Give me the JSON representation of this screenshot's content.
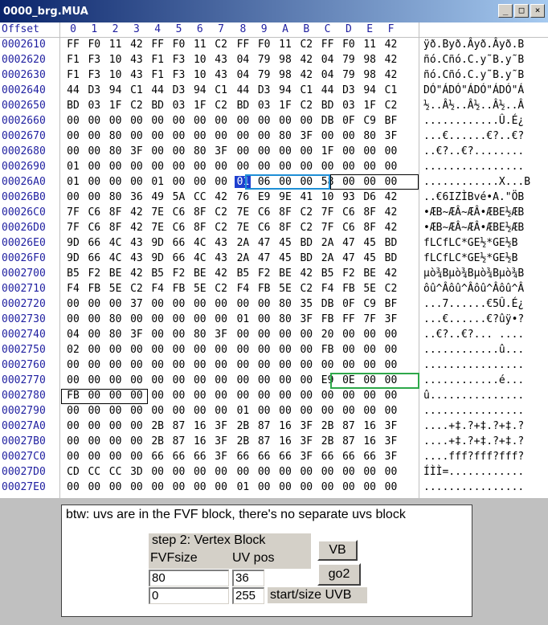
{
  "window": {
    "title": "0000_brg.MUA",
    "minimize": "_",
    "maximize": "□",
    "close": "×"
  },
  "hex": {
    "offset_header": "Offset",
    "columns": [
      "0",
      "1",
      "2",
      "3",
      "4",
      "5",
      "6",
      "7",
      "8",
      "9",
      "A",
      "B",
      "C",
      "D",
      "E",
      "F"
    ],
    "rows": [
      {
        "offset": "0002610",
        "bytes": [
          "FF",
          "F0",
          "11",
          "42",
          "FF",
          "F0",
          "11",
          "C2",
          "FF",
          "F0",
          "11",
          "C2",
          "FF",
          "F0",
          "11",
          "42"
        ],
        "ascii": "ÿð.Byð.Âyð.Âyð.B"
      },
      {
        "offset": "0002620",
        "bytes": [
          "F1",
          "F3",
          "10",
          "43",
          "F1",
          "F3",
          "10",
          "43",
          "04",
          "79",
          "98",
          "42",
          "04",
          "79",
          "98",
          "42"
        ],
        "ascii": "ñó.Cñó.C.y˜B.y˜B"
      },
      {
        "offset": "0002630",
        "bytes": [
          "F1",
          "F3",
          "10",
          "43",
          "F1",
          "F3",
          "10",
          "43",
          "04",
          "79",
          "98",
          "42",
          "04",
          "79",
          "98",
          "42"
        ],
        "ascii": "ñó.Cñó.C.y˜B.y˜B"
      },
      {
        "offset": "0002640",
        "bytes": [
          "44",
          "D3",
          "94",
          "C1",
          "44",
          "D3",
          "94",
          "C1",
          "44",
          "D3",
          "94",
          "C1",
          "44",
          "D3",
          "94",
          "C1"
        ],
        "ascii": "DÓ\"ÁDÓ\"ÁDÓ\"ÁDÓ\"Á"
      },
      {
        "offset": "0002650",
        "bytes": [
          "BD",
          "03",
          "1F",
          "C2",
          "BD",
          "03",
          "1F",
          "C2",
          "BD",
          "03",
          "1F",
          "C2",
          "BD",
          "03",
          "1F",
          "C2"
        ],
        "ascii": "½..Â½..Â½..Â½..Â"
      },
      {
        "offset": "0002660",
        "bytes": [
          "00",
          "00",
          "00",
          "00",
          "00",
          "00",
          "00",
          "00",
          "00",
          "00",
          "00",
          "00",
          "DB",
          "0F",
          "C9",
          "BF"
        ],
        "ascii": "............Û.É¿"
      },
      {
        "offset": "0002670",
        "bytes": [
          "00",
          "00",
          "80",
          "00",
          "00",
          "00",
          "00",
          "00",
          "00",
          "00",
          "80",
          "3F",
          "00",
          "00",
          "80",
          "3F"
        ],
        "ascii": "...€......€?..€?"
      },
      {
        "offset": "0002680",
        "bytes": [
          "00",
          "00",
          "80",
          "3F",
          "00",
          "00",
          "80",
          "3F",
          "00",
          "00",
          "00",
          "00",
          "1F",
          "00",
          "00",
          "00"
        ],
        "ascii": "..€?..€?........"
      },
      {
        "offset": "0002690",
        "bytes": [
          "01",
          "00",
          "00",
          "00",
          "00",
          "00",
          "00",
          "00",
          "00",
          "00",
          "00",
          "00",
          "00",
          "00",
          "00",
          "00"
        ],
        "ascii": "................"
      },
      {
        "offset": "00026A0",
        "bytes": [
          "01",
          "00",
          "00",
          "00",
          "01",
          "00",
          "00",
          "00",
          "01",
          "06",
          "00",
          "00",
          "58",
          "00",
          "00",
          "00"
        ],
        "ascii": "............X...B"
      },
      {
        "offset": "00026B0",
        "bytes": [
          "00",
          "00",
          "80",
          "36",
          "49",
          "5A",
          "CC",
          "42",
          "76",
          "E9",
          "9E",
          "41",
          "10",
          "93",
          "D6",
          "42"
        ],
        "ascii": "..€6IZÌBvé•A.\"ÖB"
      },
      {
        "offset": "00026C0",
        "bytes": [
          "7F",
          "C6",
          "8F",
          "42",
          "7E",
          "C6",
          "8F",
          "C2",
          "7E",
          "C6",
          "8F",
          "C2",
          "7F",
          "C6",
          "8F",
          "42"
        ],
        "ascii": "•ÆB~ÆÂ~ÆÂ•ÆBE½ÆB"
      },
      {
        "offset": "00026D0",
        "bytes": [
          "7F",
          "C6",
          "8F",
          "42",
          "7E",
          "C6",
          "8F",
          "C2",
          "7E",
          "C6",
          "8F",
          "C2",
          "7F",
          "C6",
          "8F",
          "42"
        ],
        "ascii": "•ÆB~ÆÂ~ÆÂ•ÆBE½ÆB"
      },
      {
        "offset": "00026E0",
        "bytes": [
          "9D",
          "66",
          "4C",
          "43",
          "9D",
          "66",
          "4C",
          "43",
          "2A",
          "47",
          "45",
          "BD",
          "2A",
          "47",
          "45",
          "BD"
        ],
        "ascii": "fLCfLC*GE½*GE½B"
      },
      {
        "offset": "00026F0",
        "bytes": [
          "9D",
          "66",
          "4C",
          "43",
          "9D",
          "66",
          "4C",
          "43",
          "2A",
          "47",
          "45",
          "BD",
          "2A",
          "47",
          "45",
          "BD"
        ],
        "ascii": "fLCfLC*GE½*GE½B"
      },
      {
        "offset": "0002700",
        "bytes": [
          "B5",
          "F2",
          "BE",
          "42",
          "B5",
          "F2",
          "BE",
          "42",
          "B5",
          "F2",
          "BE",
          "42",
          "B5",
          "F2",
          "BE",
          "42"
        ],
        "ascii": "µò¾Bµò¾Bµò¾Bµò¾B"
      },
      {
        "offset": "0002710",
        "bytes": [
          "F4",
          "FB",
          "5E",
          "C2",
          "F4",
          "FB",
          "5E",
          "C2",
          "F4",
          "FB",
          "5E",
          "C2",
          "F4",
          "FB",
          "5E",
          "C2"
        ],
        "ascii": "ôû^Âôû^Âôû^Âôû^Â"
      },
      {
        "offset": "0002720",
        "bytes": [
          "00",
          "00",
          "00",
          "37",
          "00",
          "00",
          "00",
          "00",
          "00",
          "00",
          "80",
          "35",
          "DB",
          "0F",
          "C9",
          "BF"
        ],
        "ascii": "...7......€5Û.É¿"
      },
      {
        "offset": "0002730",
        "bytes": [
          "00",
          "00",
          "80",
          "00",
          "00",
          "00",
          "00",
          "00",
          "01",
          "00",
          "80",
          "3F",
          "FB",
          "FF",
          "7F",
          "3F"
        ],
        "ascii": "...€......€?ûÿ•?"
      },
      {
        "offset": "0002740",
        "bytes": [
          "04",
          "00",
          "80",
          "3F",
          "00",
          "00",
          "80",
          "3F",
          "00",
          "00",
          "00",
          "00",
          "20",
          "00",
          "00",
          "00"
        ],
        "ascii": "..€?..€?... ...."
      },
      {
        "offset": "0002750",
        "bytes": [
          "02",
          "00",
          "00",
          "00",
          "00",
          "00",
          "00",
          "00",
          "00",
          "00",
          "00",
          "00",
          "FB",
          "00",
          "00",
          "00"
        ],
        "ascii": "............û..."
      },
      {
        "offset": "0002760",
        "bytes": [
          "00",
          "00",
          "00",
          "00",
          "00",
          "00",
          "00",
          "00",
          "00",
          "00",
          "00",
          "00",
          "00",
          "00",
          "00",
          "00"
        ],
        "ascii": "................"
      },
      {
        "offset": "0002770",
        "bytes": [
          "00",
          "00",
          "00",
          "00",
          "00",
          "00",
          "00",
          "00",
          "00",
          "00",
          "00",
          "00",
          "E9",
          "0E",
          "00",
          "00"
        ],
        "ascii": "............é..."
      },
      {
        "offset": "0002780",
        "bytes": [
          "FB",
          "00",
          "00",
          "00",
          "00",
          "00",
          "00",
          "00",
          "00",
          "00",
          "00",
          "00",
          "00",
          "00",
          "00",
          "00"
        ],
        "ascii": "û..............."
      },
      {
        "offset": "0002790",
        "bytes": [
          "00",
          "00",
          "00",
          "00",
          "00",
          "00",
          "00",
          "00",
          "01",
          "00",
          "00",
          "00",
          "00",
          "00",
          "00",
          "00"
        ],
        "ascii": "................"
      },
      {
        "offset": "00027A0",
        "bytes": [
          "00",
          "00",
          "00",
          "00",
          "2B",
          "87",
          "16",
          "3F",
          "2B",
          "87",
          "16",
          "3F",
          "2B",
          "87",
          "16",
          "3F"
        ],
        "ascii": "....+‡.?+‡.?+‡.?"
      },
      {
        "offset": "00027B0",
        "bytes": [
          "00",
          "00",
          "00",
          "00",
          "2B",
          "87",
          "16",
          "3F",
          "2B",
          "87",
          "16",
          "3F",
          "2B",
          "87",
          "16",
          "3F"
        ],
        "ascii": "....+‡.?+‡.?+‡.?"
      },
      {
        "offset": "00027C0",
        "bytes": [
          "00",
          "00",
          "00",
          "00",
          "66",
          "66",
          "66",
          "3F",
          "66",
          "66",
          "66",
          "3F",
          "66",
          "66",
          "66",
          "3F"
        ],
        "ascii": "....fff?fff?fff?"
      },
      {
        "offset": "00027D0",
        "bytes": [
          "CD",
          "CC",
          "CC",
          "3D",
          "00",
          "00",
          "00",
          "00",
          "00",
          "00",
          "00",
          "00",
          "00",
          "00",
          "00",
          "00"
        ],
        "ascii": "ÍÌÌ=............"
      },
      {
        "offset": "00027E0",
        "bytes": [
          "00",
          "00",
          "00",
          "00",
          "00",
          "00",
          "00",
          "00",
          "01",
          "00",
          "00",
          "00",
          "00",
          "00",
          "00",
          "00"
        ],
        "ascii": "................"
      }
    ]
  },
  "panel": {
    "note": "btw: uvs are in the FVF block, there's no separate uvs block",
    "step_title": "step 2: Vertex Block",
    "fvfsize_label": "FVFsize",
    "uvpos_label": "UV pos",
    "fvfsize_value": "80",
    "uvpos_value": "36",
    "start_value": "0",
    "size_value": "255",
    "vb_button": "VB",
    "go2_button": "go2",
    "start_size_label": "start/size UVB"
  },
  "colors": {
    "offset_blue": "#1f1fa0",
    "cursor_blue": "#1e3fcf",
    "box_blue": "#1e8fd6",
    "box_green": "#2ea84a",
    "box_black": "#000000"
  }
}
